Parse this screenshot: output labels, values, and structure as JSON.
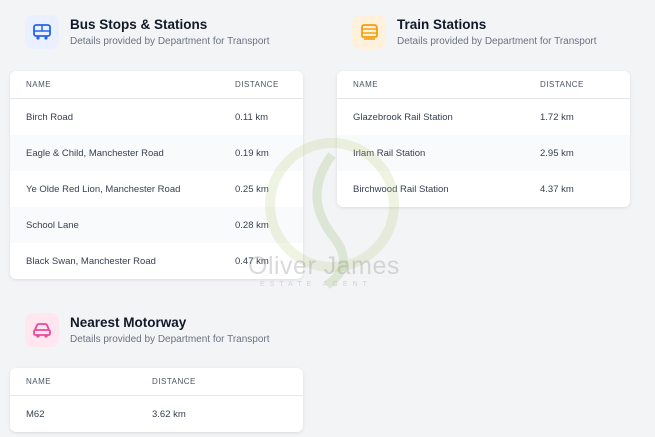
{
  "bus": {
    "title": "Bus Stops & Stations",
    "subtitle": "Details provided by Department for Transport",
    "col_name": "NAME",
    "col_distance": "DISTANCE",
    "rows": [
      {
        "name": "Birch Road",
        "distance": "0.11 km"
      },
      {
        "name": "Eagle & Child, Manchester Road",
        "distance": "0.19 km"
      },
      {
        "name": "Ye Olde Red Lion, Manchester Road",
        "distance": "0.25 km"
      },
      {
        "name": "School Lane",
        "distance": "0.28 km"
      },
      {
        "name": "Black Swan, Manchester Road",
        "distance": "0.47 km"
      }
    ]
  },
  "train": {
    "title": "Train Stations",
    "subtitle": "Details provided by Department for Transport",
    "col_name": "NAME",
    "col_distance": "DISTANCE",
    "rows": [
      {
        "name": "Glazebrook Rail Station",
        "distance": "1.72 km"
      },
      {
        "name": "Irlam Rail Station",
        "distance": "2.95 km"
      },
      {
        "name": "Birchwood Rail Station",
        "distance": "4.37 km"
      }
    ]
  },
  "motorway": {
    "title": "Nearest Motorway",
    "subtitle": "Details provided by Department for Transport",
    "col_name": "NAME",
    "col_distance": "DISTANCE",
    "rows": [
      {
        "name": "M62",
        "distance": "3.62 km"
      }
    ]
  },
  "watermark": {
    "name": "Oliver James",
    "tagline": "ESTATE AGENT"
  },
  "colors": {
    "bus_icon": "#2563eb",
    "train_icon": "#f59e0b",
    "car_icon": "#ec4899"
  }
}
